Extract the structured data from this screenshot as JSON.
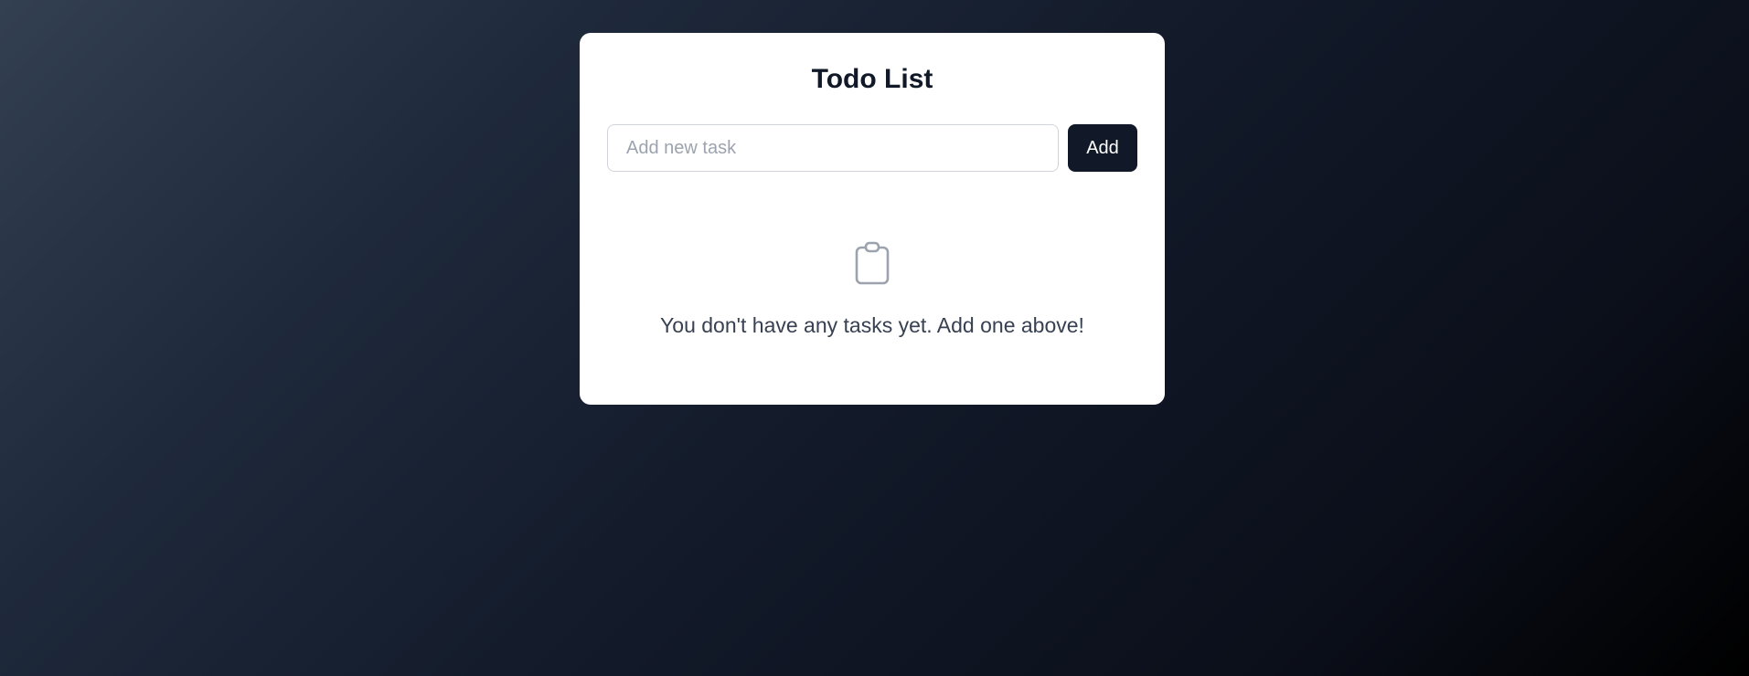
{
  "app": {
    "title": "Todo List"
  },
  "add_form": {
    "input_placeholder": "Add new task",
    "input_value": "",
    "add_label": "Add"
  },
  "empty_state": {
    "icon": "clipboard-icon",
    "message": "You don't have any tasks yet. Add one above!"
  },
  "colors": {
    "card_background": "#ffffff",
    "button_background": "#111827",
    "title_text": "#111827",
    "message_text": "#374151",
    "icon_stroke": "#9ca3af"
  }
}
